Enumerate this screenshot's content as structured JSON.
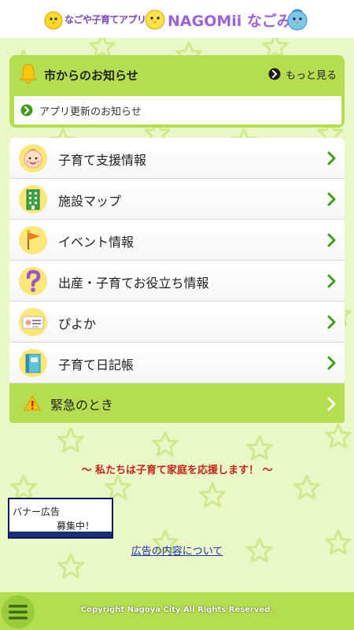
{
  "header": {
    "logo_sub": "なごや子育てアプリ",
    "logo_main": "NAGOMii なごみー"
  },
  "notice": {
    "title": "市からのお知らせ",
    "more_label": "もっと見る",
    "items": [
      {
        "label": "アプリ更新のお知らせ"
      }
    ]
  },
  "menu": {
    "items": [
      {
        "label": "子育て支援情報",
        "icon": "baby-face-icon"
      },
      {
        "label": "施設マップ",
        "icon": "building-icon"
      },
      {
        "label": "イベント情報",
        "icon": "flag-icon"
      },
      {
        "label": "出産・子育てお役立ち情報",
        "icon": "question-mark-icon"
      },
      {
        "label": "ぴよか",
        "icon": "card-icon"
      },
      {
        "label": "子育て日記帳",
        "icon": "notebook-icon"
      }
    ],
    "emergency": {
      "label": "緊急のとき",
      "icon": "warning-icon"
    }
  },
  "slogan": "～ 私たちは子育て家庭を応援します！ ～",
  "banner": {
    "line1": "バナー広告",
    "line2": "募集中！"
  },
  "ad_info_link": "広告の内容について",
  "footer": {
    "copyright": "Copyright Nagoya City All Rights Reserved."
  },
  "colors": {
    "background": "#eaf7c6",
    "accent_green": "#b4de4f",
    "chevron_green": "#3f9e19",
    "slogan_red": "#c0281e",
    "link_blue": "#1c2ea8"
  }
}
